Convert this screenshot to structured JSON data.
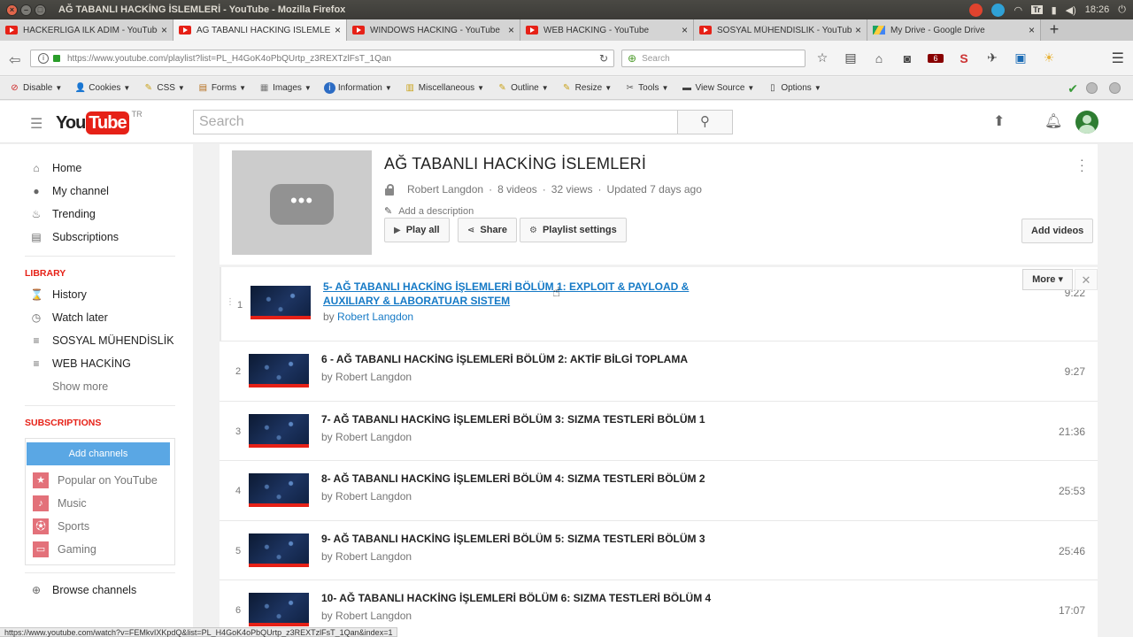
{
  "window": {
    "title": "AĞ TABANLI HACKİNG İSLEMLERİ - YouTube - Mozilla Firefox",
    "tray": {
      "keyboard": "Tr",
      "clock": "18:26"
    }
  },
  "tabs": [
    {
      "label": "HACKERLIĞA İLK ADIM - YouTube",
      "icon": "youtube-icon",
      "active": false
    },
    {
      "label": "AĞ TABANLI HACKİNG İSLEMLERİ",
      "icon": "youtube-icon",
      "active": true
    },
    {
      "label": "WINDOWS HACKING - YouTube",
      "icon": "youtube-icon",
      "active": false
    },
    {
      "label": "WEB HACKİNG - YouTube",
      "icon": "youtube-icon",
      "active": false
    },
    {
      "label": "SOSYAL MÜHENDİSLİK - YouTube",
      "icon": "youtube-icon",
      "active": false
    },
    {
      "label": "My Drive - Google Drive",
      "icon": "google-drive-icon",
      "active": false
    }
  ],
  "navbar": {
    "url": "https://www.youtube.com/playlist?list=PL_H4GoK4oPbQUrtp_z3REXTzlFsT_1Qan",
    "search_placeholder": "Search",
    "badge_count": "6"
  },
  "devbar": {
    "items": [
      "Disable",
      "Cookies",
      "CSS",
      "Forms",
      "Images",
      "Information",
      "Miscellaneous",
      "Outline",
      "Resize",
      "Tools",
      "View Source",
      "Options"
    ]
  },
  "youtube": {
    "logo_you": "You",
    "logo_tube": "Tube",
    "country": "TR",
    "search_placeholder": "Search",
    "guide": {
      "main": [
        {
          "label": "Home",
          "icon": "home-icon"
        },
        {
          "label": "My channel",
          "icon": "person-icon"
        },
        {
          "label": "Trending",
          "icon": "flame-icon"
        },
        {
          "label": "Subscriptions",
          "icon": "subscriptions-icon"
        }
      ],
      "library_heading": "LIBRARY",
      "library": [
        {
          "label": "History",
          "icon": "hourglass-icon"
        },
        {
          "label": "Watch later",
          "icon": "clock-icon"
        },
        {
          "label": "SOSYAL MÜHENDİSLİK",
          "icon": "playlist-icon"
        },
        {
          "label": "WEB HACKİNG",
          "icon": "playlist-icon"
        }
      ],
      "show_more": "Show more",
      "subscriptions_heading": "SUBSCRIPTIONS",
      "add_channels": "Add channels",
      "subscriptions": [
        {
          "label": "Popular on YouTube",
          "icon": "star-icon"
        },
        {
          "label": "Music",
          "icon": "music-icon"
        },
        {
          "label": "Sports",
          "icon": "ball-icon"
        },
        {
          "label": "Gaming",
          "icon": "gamepad-icon"
        }
      ],
      "browse_channels": "Browse channels"
    },
    "playlist": {
      "title": "AĞ TABANLI HACKİNG İSLEMLERİ",
      "owner": "Robert Langdon",
      "video_count": "8 videos",
      "views": "32 views",
      "updated": "Updated 7 days ago",
      "add_description": "Add a description",
      "play_all": "Play all",
      "share": "Share",
      "settings": "Playlist settings",
      "add_videos": "Add videos",
      "more": "More"
    },
    "videos": [
      {
        "index": "1",
        "title": "5- AĞ TABANLI HACKİNG İŞLEMLERİ BÖLÜM 1: EXPLOIT & PAYLOAD & AUXILIARY & LABORATUAR SISTEM",
        "by": "by",
        "channel": "Robert Langdon",
        "duration": "9:22"
      },
      {
        "index": "2",
        "title": "6 - AĞ TABANLI HACKİNG İŞLEMLERİ BÖLÜM 2: AKTİF BİLGİ TOPLAMA",
        "by": "by",
        "channel": "Robert Langdon",
        "duration": "9:27"
      },
      {
        "index": "3",
        "title": "7- AĞ TABANLI HACKİNG İŞLEMLERİ BÖLÜM 3: SIZMA TESTLERİ BÖLÜM 1",
        "by": "by",
        "channel": "Robert Langdon",
        "duration": "21:36"
      },
      {
        "index": "4",
        "title": "8- AĞ TABANLI HACKİNG İŞLEMLERİ BÖLÜM 4: SIZMA TESTLERİ BÖLÜM 2",
        "by": "by",
        "channel": "Robert Langdon",
        "duration": "25:53"
      },
      {
        "index": "5",
        "title": "9- AĞ TABANLI HACKİNG İŞLEMLERİ BÖLÜM 5: SIZMA TESTLERİ BÖLÜM 3",
        "by": "by",
        "channel": "Robert Langdon",
        "duration": "25:46"
      },
      {
        "index": "6",
        "title": "10- AĞ TABANLI HACKİNG İŞLEMLERİ BÖLÜM 6: SIZMA TESTLERİ BÖLÜM 4",
        "by": "by",
        "channel": "Robert Langdon",
        "duration": "17:07"
      }
    ]
  },
  "status_url": "https://www.youtube.com/watch?v=FEMkvIXKpdQ&list=PL_H4GoK4oPbQUrtp_z3REXTzlFsT_1Qan&index=1",
  "colors": {
    "brand_red": "#e62117",
    "link_blue": "#167ac6",
    "add_channels_blue": "#5aa7e4"
  }
}
